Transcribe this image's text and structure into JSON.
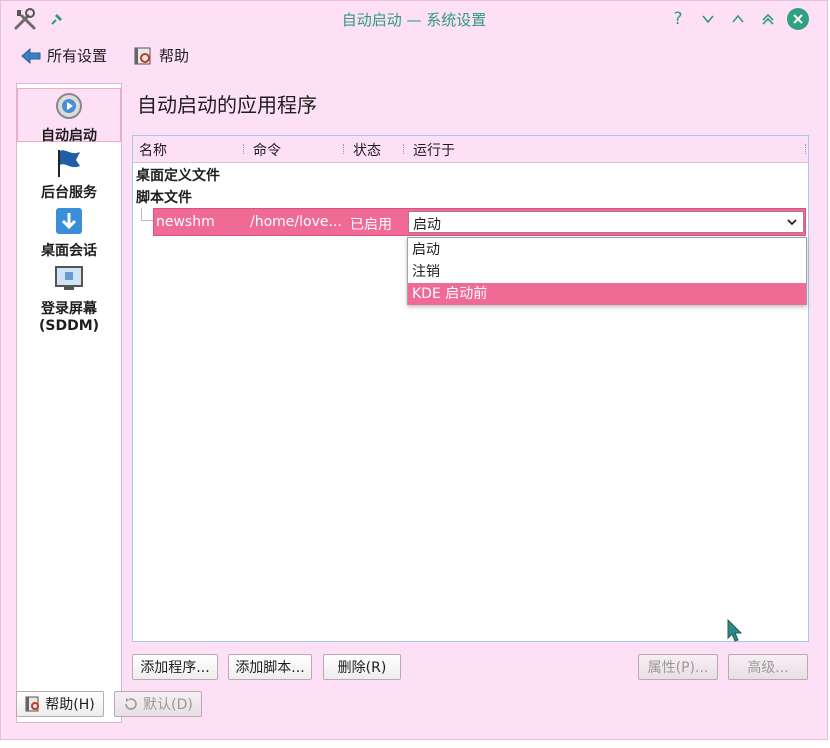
{
  "window": {
    "title": "自动启动 — 系统设置",
    "accent": "#2e9c7d",
    "controls": {
      "help": "?",
      "minimize": "⌄",
      "maximize": "⌃",
      "keep_above": "︽"
    }
  },
  "toolbar": {
    "all_settings": "所有设置",
    "help": "帮助"
  },
  "sidebar": {
    "items": [
      {
        "label": "自动启动",
        "icon": "autostart-icon",
        "selected": true
      },
      {
        "label": "后台服务",
        "icon": "flag-icon"
      },
      {
        "label": "桌面会话",
        "icon": "download-arrow-icon"
      },
      {
        "label": "登录屏幕\n(SDDM)",
        "label_line1": "登录屏幕",
        "label_line2": "(SDDM)",
        "icon": "monitor-icon"
      }
    ]
  },
  "main": {
    "title": "自动启动的应用程序",
    "columns": [
      "名称",
      "命令",
      "状态",
      "运行于"
    ],
    "groups": [
      "桌面定义文件",
      "脚本文件"
    ],
    "row": {
      "name": "newshm",
      "command": "/home/love...",
      "status": "已启用",
      "run_on": "启动"
    },
    "dropdown_options": [
      "启动",
      "注销",
      "KDE 启动前"
    ],
    "highlighted_option": "KDE 启动前",
    "buttons": {
      "add_program": "添加程序...",
      "add_script": "添加脚本...",
      "remove": "删除(R)",
      "properties": "属性(P)...",
      "advanced": "高级..."
    }
  },
  "footer": {
    "help": "帮助(H)",
    "defaults": "默认(D)"
  },
  "colors": {
    "selection": "#f06a96",
    "window_bg": "#fde0f6"
  }
}
